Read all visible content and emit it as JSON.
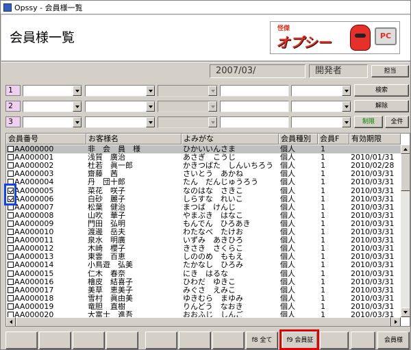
{
  "window": {
    "title": "Opssy - 会員様一覧"
  },
  "header": {
    "page_title": "会員様一覧",
    "logo_small": "怪傑",
    "logo_text": "オプシー",
    "logo_pc": "PC"
  },
  "info": {
    "date": "2007/03/",
    "user": "開発者",
    "staff_button": "担当"
  },
  "filters": {
    "rows": [
      "1",
      "2",
      "3"
    ],
    "search_button": "検索",
    "clear_button": "解除",
    "restrict_button": "制限",
    "all_button": "全件"
  },
  "colors": {
    "restrict_text": "#008000"
  },
  "table": {
    "columns": [
      "会員番号",
      "お客様名",
      "よみがな",
      "会員種別",
      "会員F",
      "有効期限"
    ],
    "rows": [
      {
        "checked": false,
        "id": "AA000000",
        "name": "非　会　員　様",
        "kana": "ひかいいんさま",
        "type": "個人",
        "flag": "1",
        "expiry": "",
        "selected": true
      },
      {
        "checked": false,
        "id": "AA000001",
        "name": "浅質　廣治",
        "kana": "あさぎ　こうじ",
        "type": "個人",
        "flag": "1",
        "expiry": "2010/01/31"
      },
      {
        "checked": false,
        "id": "AA000002",
        "name": "杜若　眞一郎",
        "kana": "かきつばた　しんいちろう",
        "type": "個人",
        "flag": "1",
        "expiry": "2010/02/28"
      },
      {
        "checked": false,
        "id": "AA000003",
        "name": "齋藤　茜",
        "kana": "さいとう　あかね",
        "type": "個人",
        "flag": "1",
        "expiry": "2010/03/31"
      },
      {
        "checked": false,
        "id": "AA000004",
        "name": "丹　団十郎",
        "kana": "たん　だんじゅうろう",
        "type": "個人",
        "flag": "1",
        "expiry": "2010/03/31"
      },
      {
        "checked": true,
        "id": "AA000005",
        "name": "菜花　咲子",
        "kana": "なのはな　さきこ",
        "type": "個人",
        "flag": "1",
        "expiry": "2010/03/31"
      },
      {
        "checked": true,
        "id": "AA000006",
        "name": "白砂　麗子",
        "kana": "しらすな　れいこ",
        "type": "個人",
        "flag": "1",
        "expiry": "2010/03/31"
      },
      {
        "checked": false,
        "id": "AA000007",
        "name": "松葉　健治",
        "kana": "まつば　けんじ",
        "type": "個人",
        "flag": "1",
        "expiry": "2010/03/31"
      },
      {
        "checked": false,
        "id": "AA000008",
        "name": "山吹　華子",
        "kana": "やまぶき　はなこ",
        "type": "個人",
        "flag": "1",
        "expiry": "2010/03/31"
      },
      {
        "checked": false,
        "id": "AA000009",
        "name": "門田　弘明",
        "kana": "もんでん　ひろあき",
        "type": "個人",
        "flag": "1",
        "expiry": "2010/03/31"
      },
      {
        "checked": false,
        "id": "AA000010",
        "name": "渡邊　岳夫",
        "kana": "わたなべ　たけお",
        "type": "個人",
        "flag": "1",
        "expiry": "2010/03/31"
      },
      {
        "checked": false,
        "id": "AA000011",
        "name": "泉水　明廣",
        "kana": "いずみ　あきひろ",
        "type": "個人",
        "flag": "1",
        "expiry": "2010/03/31"
      },
      {
        "checked": false,
        "id": "AA000012",
        "name": "木崎　櫻子",
        "kana": "きさき　さくらこ",
        "type": "個人",
        "flag": "1",
        "expiry": "2010/03/31"
      },
      {
        "checked": false,
        "id": "AA000013",
        "name": "東雲　百恵",
        "kana": "しののめ　ももえ",
        "type": "個人",
        "flag": "1",
        "expiry": "2010/03/31"
      },
      {
        "checked": false,
        "id": "AA000014",
        "name": "小鳥遊　弘美",
        "kana": "たかなし　ひろみ",
        "type": "個人",
        "flag": "1",
        "expiry": "2010/03/31"
      },
      {
        "checked": false,
        "id": "AA000015",
        "name": "仁木　春奈",
        "kana": "にき　はるな",
        "type": "個人",
        "flag": "1",
        "expiry": "2010/03/31"
      },
      {
        "checked": false,
        "id": "AA000016",
        "name": "檜皮　結喜子",
        "kana": "ひわだ　ゆきこ",
        "type": "個人",
        "flag": "1",
        "expiry": "2010/03/31"
      },
      {
        "checked": false,
        "id": "AA000017",
        "name": "美草　恵美子",
        "kana": "みぐさ　えみこ",
        "type": "個人",
        "flag": "1",
        "expiry": "2010/03/31"
      },
      {
        "checked": false,
        "id": "AA000018",
        "name": "雪村　眞由美",
        "kana": "ゆきむら　まゆみ",
        "type": "個人",
        "flag": "1",
        "expiry": "2010/03/31"
      },
      {
        "checked": false,
        "id": "AA000019",
        "name": "竜胆　直樹",
        "kana": "りんどう　なおき",
        "type": "個人",
        "flag": "1",
        "expiry": "2010/03/31"
      },
      {
        "checked": false,
        "id": "AA000020",
        "name": "大富士　進吾",
        "kana": "おおふじ　しんご",
        "type": "個人",
        "flag": "1",
        "expiry": "2010/03/31"
      }
    ]
  },
  "fkeys": {
    "f8": "f8 全て",
    "f9": "f9 会員証",
    "f12": "会員様"
  }
}
